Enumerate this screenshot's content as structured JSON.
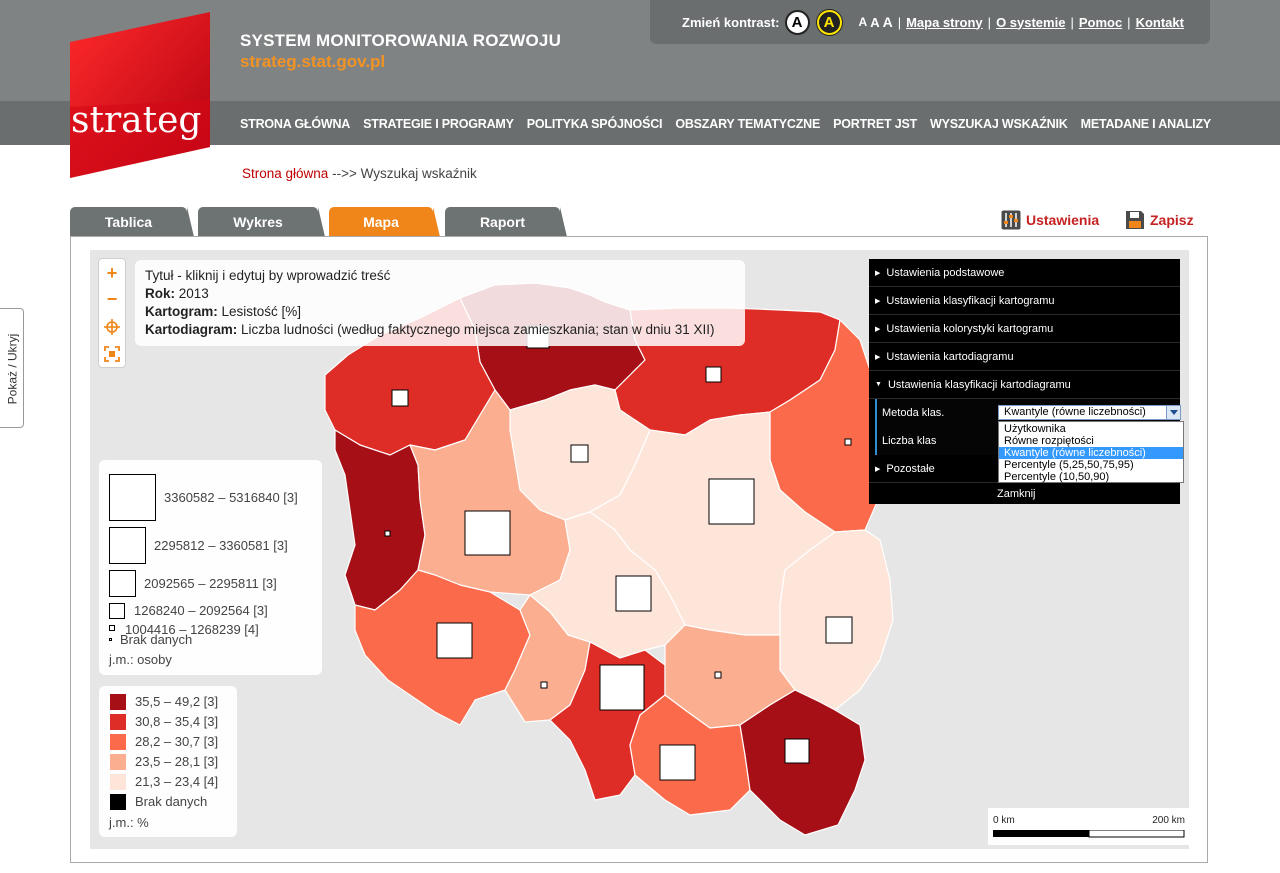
{
  "header": {
    "logo_text": "strateg",
    "title": "SYSTEM MONITOROWANIA ROZWOJU",
    "url": "strateg.stat.gov.pl",
    "contrast_label": "Zmień kontrast:",
    "contrast_normal": "A",
    "contrast_high": "A",
    "font_sizes": [
      "A",
      "A",
      "A"
    ],
    "links": [
      "Mapa strony",
      "O systemie",
      "Pomoc",
      "Kontakt"
    ],
    "separator": "|"
  },
  "nav": {
    "items": [
      "STRONA GŁÓWNA",
      "STRATEGIE I PROGRAMY",
      "POLITYKA SPÓJNOŚCI",
      "OBSZARY TEMATYCZNE",
      "PORTRET JST",
      "WYSZUKAJ WSKAŹNIK",
      "METADANE I ANALIZY"
    ]
  },
  "breadcrumb": {
    "home": "Strona główna",
    "separator": "-->>",
    "current": "Wyszukaj wskaźnik"
  },
  "side_toggle": "Pokaż / Ukryj",
  "tabs": [
    "Tablica",
    "Wykres",
    "Mapa",
    "Raport"
  ],
  "active_tab": "Mapa",
  "actions": {
    "settings": "Ustawienia",
    "save": "Zapisz"
  },
  "zoom": {
    "in": "+",
    "out": "−"
  },
  "map_title": {
    "title": "Tytuł - kliknij i edytuj by wprowadzić treść",
    "year_label": "Rok:",
    "year": "2013",
    "cartogram_label": "Kartogram:",
    "cartogram": "Lesistość [%]",
    "diagram_label": "Kartodiagram:",
    "diagram": "Liczba ludności (według faktycznego miejsca zamieszkania; stan w dniu 31 XII)"
  },
  "legend_diagram": {
    "classes": [
      "3360582 – 5316840 [3]",
      "2295812 – 3360581 [3]",
      "2092565 – 2295811 [3]",
      "1268240 – 2092564 [3]",
      "1004416 – 1268239 [4]"
    ],
    "no_data": "Brak danych",
    "unit": "j.m.: osoby"
  },
  "legend_cartogram": {
    "classes": [
      {
        "label": "35,5 – 49,2 [3]",
        "color": "#a50f15"
      },
      {
        "label": "30,8 – 35,4 [3]",
        "color": "#de2d26"
      },
      {
        "label": "28,2 – 30,7 [3]",
        "color": "#fb6a4a"
      },
      {
        "label": "23,5 – 28,1 [3]",
        "color": "#fcae91"
      },
      {
        "label": "21,3 – 23,4 [4]",
        "color": "#fee5d9"
      }
    ],
    "no_data": "Brak danych",
    "no_data_color": "#000000",
    "unit": "j.m.: %"
  },
  "settings_panel": {
    "items": [
      "Ustawienia podstawowe",
      "Ustawienia klasyfikacji kartogramu",
      "Ustawienia kolorystyki kartogramu",
      "Ustawienia kartodiagramu",
      "Ustawienia klasyfikacji kartodiagramu"
    ],
    "method_label": "Metoda klas.",
    "count_label": "Liczba klas",
    "other": "Pozostałe",
    "close": "Zamknij",
    "method_value": "Kwantyle (równe liczebności)",
    "method_options": [
      "Użytkownika",
      "Równe rozpiętości",
      "Kwantyle (równe liczebności)",
      "Percentyle (5,25,50,75,95)",
      "Percentyle (10,50,90)"
    ]
  },
  "scale": {
    "start": "0 km",
    "end": "200 km"
  },
  "colors": {
    "accent": "#f08519",
    "brand_red": "#c62222",
    "header_grey": "#7f8383"
  }
}
